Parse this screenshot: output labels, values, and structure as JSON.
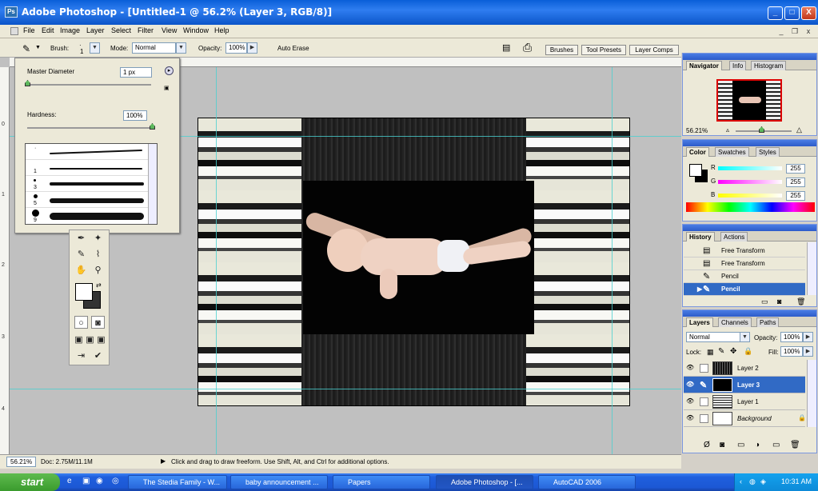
{
  "window": {
    "title": "Adobe Photoshop - [Untitled-1 @ 56.2% (Layer 3, RGB/8)]",
    "logo": "Ps"
  },
  "window_controls": {
    "minimize": "_",
    "maximize": "□",
    "close": "X"
  },
  "menu": [
    "File",
    "Edit",
    "Image",
    "Layer",
    "Select",
    "Filter",
    "View",
    "Window",
    "Help"
  ],
  "doc_controls": {
    "minimize": "_",
    "restore": "❐",
    "close": "x"
  },
  "options": {
    "brush_label": "Brush:",
    "brush_size": "1",
    "mode_label": "Mode:",
    "mode_value": "Normal",
    "opacity_label": "Opacity:",
    "opacity_value": "100%",
    "auto_erase_label": "Auto Erase"
  },
  "well_tabs": [
    "Brushes",
    "Tool Presets",
    "Layer Comps"
  ],
  "ruler": {
    "left_numbers": [
      "0",
      "1",
      "2",
      "3",
      "4"
    ]
  },
  "brush_panel": {
    "master_diameter_label": "Master Diameter",
    "master_diameter_value": "1 px",
    "hardness_label": "Hardness:",
    "hardness_value": "100%",
    "brushes": [
      {
        "size": "1"
      },
      {
        "size": "3"
      },
      {
        "size": "5"
      },
      {
        "size": "9"
      }
    ]
  },
  "navigator": {
    "tabs": [
      "Navigator",
      "Info",
      "Histogram"
    ],
    "zoom": "56.21%"
  },
  "color": {
    "tabs": [
      "Color",
      "Swatches",
      "Styles"
    ],
    "r_label": "R",
    "g_label": "G",
    "b_label": "B",
    "r": "255",
    "g": "255",
    "b": "255"
  },
  "history": {
    "tabs": [
      "History",
      "Actions"
    ],
    "items": [
      "Free Transform",
      "Free Transform",
      "Pencil",
      "Pencil"
    ],
    "selected_index": 3
  },
  "layers": {
    "tabs": [
      "Layers",
      "Channels",
      "Paths"
    ],
    "blend_mode": "Normal",
    "opacity_label": "Opacity:",
    "opacity_value": "100%",
    "lock_label": "Lock:",
    "fill_label": "Fill:",
    "fill_value": "100%",
    "items": [
      "Layer 2",
      "Layer 3",
      "Layer 1",
      "Background"
    ],
    "selected": "Layer 3"
  },
  "status": {
    "zoom": "56.21%",
    "doc": "Doc: 2.75M/11.1M",
    "hint": "Click and drag to draw freeform.  Use Shift, Alt, and Ctrl for additional options."
  },
  "taskbar": {
    "start": "start",
    "tasks": [
      "The Stedia Family - W...",
      "baby announcement ...",
      "Papers",
      "Adobe Photoshop - [...",
      "AutoCAD 2006"
    ],
    "clock": "10:31 AM"
  }
}
